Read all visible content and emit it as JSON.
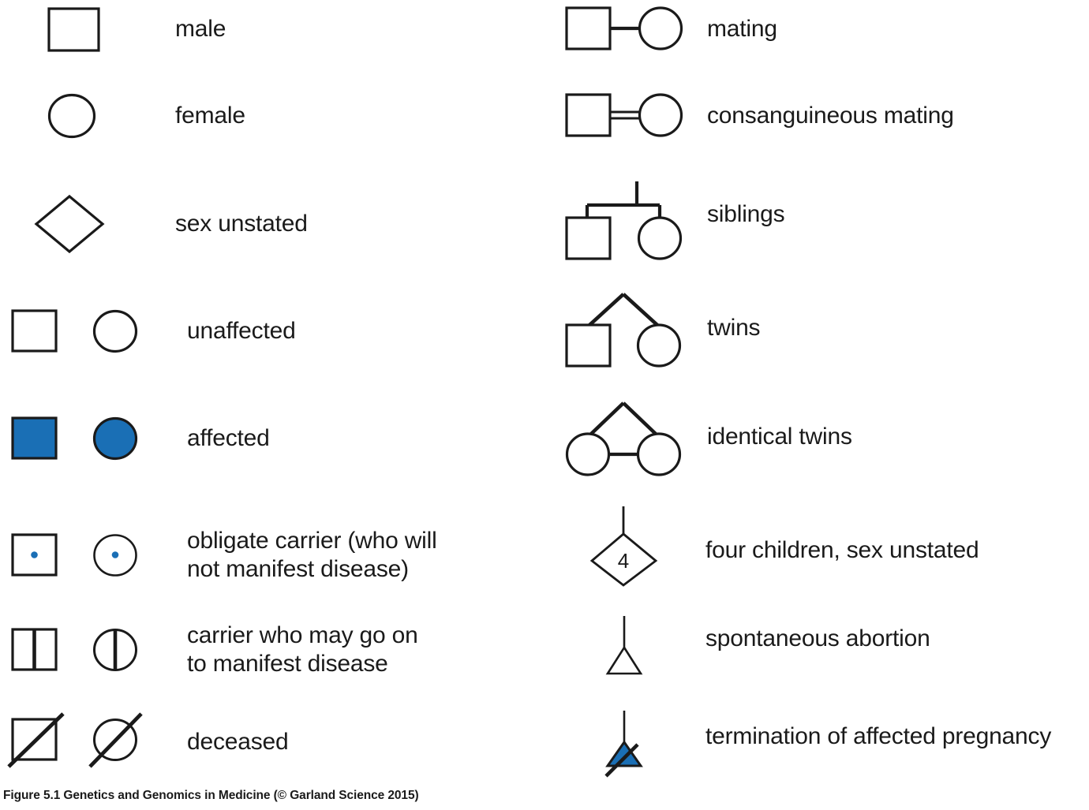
{
  "figure": {
    "caption": "Figure 5.1  Genetics and Genomics in Medicine (© Garland Science 2015)",
    "background_color": "#ffffff",
    "stroke_color": "#1a1a1a",
    "affected_fill_color": "#1a6fb5",
    "carrier_dot_color": "#1a6fb5"
  },
  "left_column": {
    "rows": [
      {
        "label": "male",
        "symbols": [
          "open-square"
        ]
      },
      {
        "label": "female",
        "symbols": [
          "open-circle"
        ]
      },
      {
        "label": "sex unstated",
        "symbols": [
          "open-diamond"
        ]
      },
      {
        "label": "unaffected",
        "symbols": [
          "open-square",
          "open-circle"
        ]
      },
      {
        "label": "affected",
        "symbols": [
          "filled-square",
          "filled-circle"
        ]
      },
      {
        "label": "obligate carrier (who will\nnot manifest disease)",
        "symbols": [
          "dotted-square",
          "dotted-circle"
        ]
      },
      {
        "label": "carrier who may go on\nto manifest disease",
        "symbols": [
          "half-line-square",
          "half-line-circle"
        ]
      },
      {
        "label": "deceased",
        "symbols": [
          "slashed-square",
          "slashed-circle"
        ]
      }
    ]
  },
  "right_column": {
    "rows": [
      {
        "label": "mating",
        "symbols": [
          "mating-pair"
        ]
      },
      {
        "label": "consanguineous mating",
        "symbols": [
          "consanguineous-pair"
        ]
      },
      {
        "label": "siblings",
        "symbols": [
          "siblings-sibship"
        ]
      },
      {
        "label": "twins",
        "symbols": [
          "twins-pair"
        ]
      },
      {
        "label": "identical twins",
        "symbols": [
          "identical-twins-pair"
        ]
      },
      {
        "label": "four children, sex unstated",
        "symbols": [
          "numbered-diamond"
        ],
        "count_in_symbol": "4"
      },
      {
        "label": "spontaneous abortion",
        "symbols": [
          "open-triangle"
        ]
      },
      {
        "label": "termination of affected pregnancy",
        "symbols": [
          "slashed-filled-triangle"
        ]
      }
    ]
  }
}
